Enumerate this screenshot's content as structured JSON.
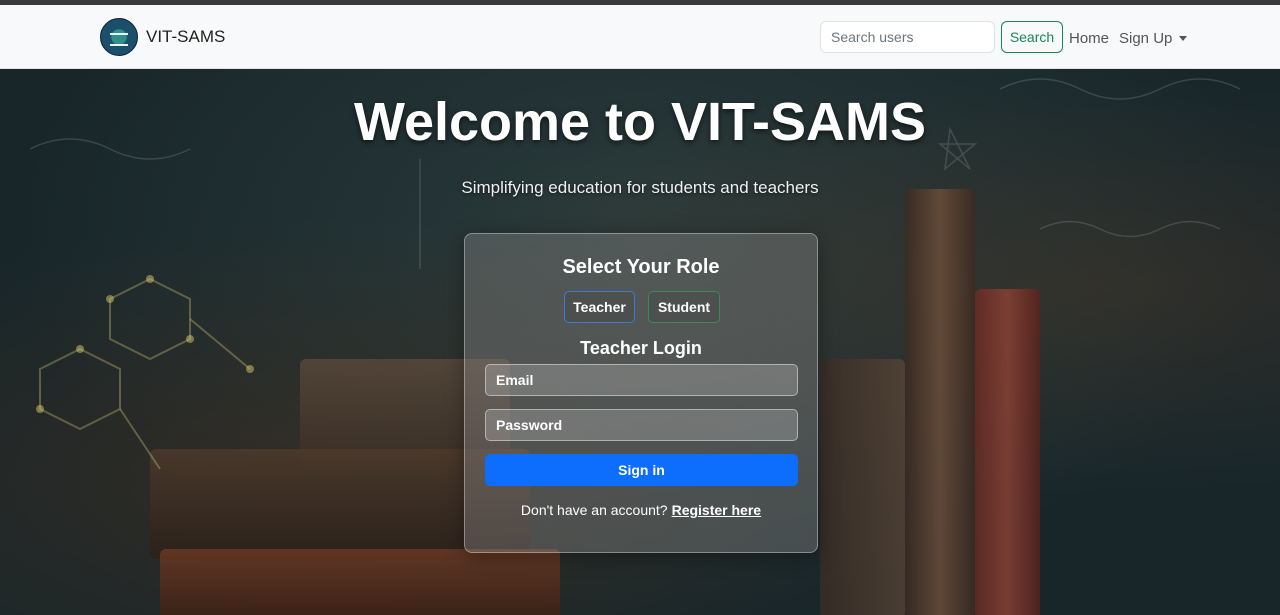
{
  "navbar": {
    "brand": "VIT-SAMS",
    "search_placeholder": "Search users",
    "search_button": "Search",
    "home": "Home",
    "signup": "Sign Up"
  },
  "hero": {
    "title": "Welcome to VIT-SAMS",
    "subtitle": "Simplifying education for students and teachers"
  },
  "login_card": {
    "title": "Select Your Role",
    "roles": [
      "Teacher",
      "Student"
    ],
    "selected_role": "Teacher",
    "form_title": "Teacher Login",
    "email_placeholder": "Email",
    "password_placeholder": "Password",
    "signin_button": "Sign in",
    "register_prompt": "Don't have an account?",
    "register_link": "Register here"
  },
  "colors": {
    "primary": "#0d6efd",
    "success": "#198754"
  }
}
